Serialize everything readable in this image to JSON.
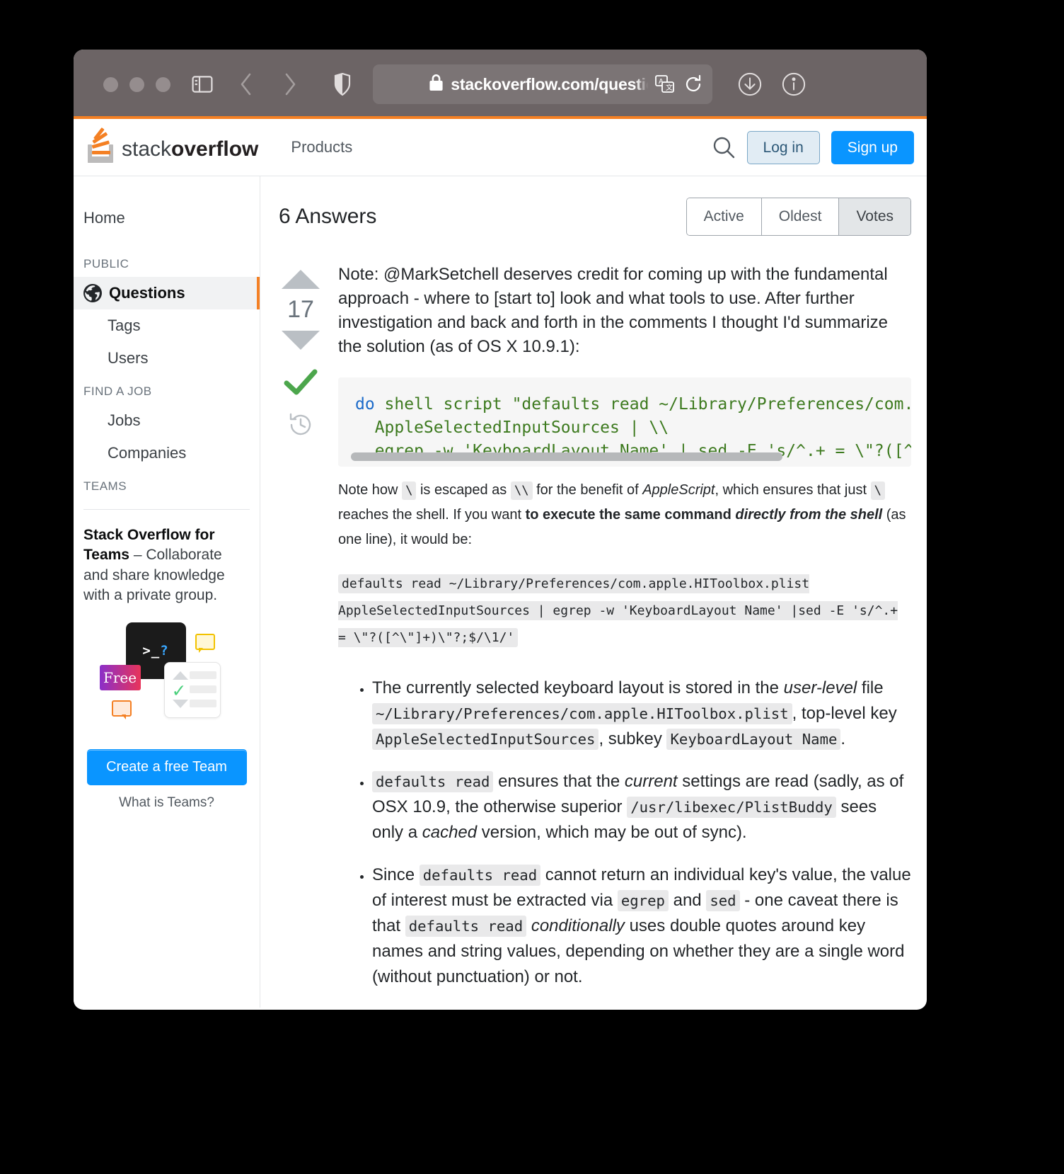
{
  "browser": {
    "traffic_lights": [
      "close",
      "minimize",
      "zoom"
    ],
    "sidebar_toggle_icon": "sidebar-icon",
    "back_icon": "chevron-left-icon",
    "forward_icon": "chevron-right-icon",
    "shield_icon": "shield-icon",
    "lock_icon": "lock-icon",
    "url": "stackoverflow.com/questio",
    "translate_icon": "translate-icon",
    "reload_icon": "reload-icon",
    "downloads_icon": "download-icon",
    "info_icon": "info-icon"
  },
  "topnav": {
    "logo_light": "stack",
    "logo_bold": "overflow",
    "products": "Products",
    "search_icon": "search-icon",
    "login": "Log in",
    "signup": "Sign up"
  },
  "sidebar": {
    "home": "Home",
    "sections": [
      {
        "heading": "PUBLIC",
        "items": [
          "Questions",
          "Tags",
          "Users"
        ]
      },
      {
        "heading": "FIND A JOB",
        "items": [
          "Jobs",
          "Companies"
        ]
      },
      {
        "heading": "TEAMS",
        "items": []
      }
    ],
    "active_item": "Questions",
    "teams": {
      "title": "Stack Overflow for Teams",
      "tagline": " – Collaborate and share knowledge with a private group.",
      "art": {
        "prompt": ">_",
        "question": "?",
        "badge": "Free",
        "check": "✓"
      },
      "cta": "Create a free Team",
      "link": "What is Teams?"
    }
  },
  "main": {
    "answers_heading": "6 Answers",
    "sort_tabs": [
      "Active",
      "Oldest",
      "Votes"
    ],
    "selected_sort": "Votes",
    "answer": {
      "votes": "17",
      "accepted": true,
      "accept_icon": "checkmark-icon",
      "history_icon": "history-clock-icon",
      "upvote_icon": "arrow-up-icon",
      "downvote_icon": "arrow-down-icon",
      "intro": "Note: @MarkSetchell deserves credit for coming up with the fundamental approach - where to [start to] look and what tools to use. After further investigation and back and forth in the comments I thought I'd summarize the solution (as of OS X 10.9.1):",
      "code_block": {
        "line1_kw": "do",
        "line1_rest": " shell script \"defaults read ~/Library/Preferences/com.appl",
        "line2": "  AppleSelectedInputSources | \\\\",
        "line3": "  egrep -w 'KeyboardLayout Name' | sed -E 's/^.+ = \\\"?([^\\\"]+)"
      },
      "para2": {
        "t1": "Note how ",
        "c1": "\\",
        "t2": " is escaped as ",
        "c2": "\\\\",
        "t3": " for the benefit of ",
        "i1": "AppleScript",
        "t4": ", which ensures that just ",
        "c3": "\\",
        "t5": " reaches the shell. If you want ",
        "b1": "to execute the same command ",
        "bi1": "directly from the shell",
        "t6": " (as one line), it would be:"
      },
      "inline_command": "defaults read ~/Library/Preferences/com.apple.HIToolbox.plist AppleSelectedInputSources | egrep -w 'KeyboardLayout Name' |sed -E 's/^.+ = \\\"?([^\\\"]+)\\\"?;$/\\1/'",
      "bullets": [
        {
          "t1": "The currently selected keyboard layout is stored in the ",
          "i1": "user-level",
          "t2": " file ",
          "c1": "~/Library/Preferences/com.apple.HIToolbox.plist",
          "t3": ", top-level key ",
          "c2": "AppleSelectedInputSources",
          "t4": ", subkey ",
          "c3": "KeyboardLayout Name",
          "t5": "."
        },
        {
          "c0": "defaults read",
          "t1": " ensures that the ",
          "i1": "current",
          "t2": " settings are read (sadly, as of OSX 10.9, the otherwise superior ",
          "c1": "/usr/libexec/PlistBuddy",
          "t3": " sees only a ",
          "i2": "cached",
          "t4": " version, which may be out of sync)."
        },
        {
          "t0": "Since ",
          "c0": "defaults read",
          "t1": " cannot return an individual key's value, the value of interest must be extracted via ",
          "c1": "egrep",
          "t2": " and ",
          "c2": "sed",
          "t3": " - one caveat there is that ",
          "c3": "defaults read",
          "t4": " ",
          "i1": "conditionally",
          "t5": " uses double quotes around key names and string values, depending on whether they are a single word (without punctuation) or not."
        }
      ]
    }
  },
  "colors": {
    "accent_orange": "#f48024",
    "link_blue": "#0a95ff",
    "code_green": "#3d7a1f",
    "accept_green": "#4ca64c"
  }
}
